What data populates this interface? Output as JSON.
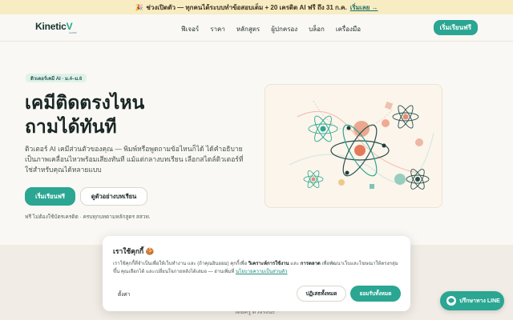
{
  "announcement": {
    "icon": "party-popper-icon",
    "text": "ช่วงเปิดตัว — ทุกคนได้ระบบทำข้อสอบเต็ม + 20 เครดิต AI ฟรี ถึง 31 ก.ค.",
    "cta": "เริ่มเลย →"
  },
  "nav": {
    "logo_main": "Kinetic",
    "logo_accent": "V",
    "logo_sub": "LEARN",
    "links": [
      "ฟีเจอร์",
      "ราคา",
      "หลักสูตร",
      "ผู้ปกครอง",
      "บล็อก",
      "เครื่องมือ"
    ],
    "cta": "เริ่มเรียนฟรี"
  },
  "hero": {
    "badge": "ติวเตอร์เคมี AI · ม.4–ม.6",
    "title_line1": "เคมีติดตรงไหน",
    "title_line2": "ถามได้ทันที",
    "description": "ติวเตอร์ AI เคมีส่วนตัวของคุณ — พิมพ์หรือพูดถามข้อไหนก็ได้ ได้คำอธิบายเป็นภาพเคลื่อนไหวพร้อมเสียงทันที แม้แต่กลางบทเรียน เลือกสไตล์ติวเตอร์ที่ใช่สำหรับคุณได้หลายแบบ",
    "primary_button": "เริ่มเรียนฟรี",
    "secondary_button": "ดูตัวอย่างบทเรียน",
    "note": "ฟรี ไม่ต้องใช้บัตรเครดิต · ครบทุกบทตามหลักสูตร สสวท."
  },
  "lower_section": {
    "text": "โดยครู ตัวจริงนะ"
  },
  "cookie": {
    "title": "เราใช้คุกกี้ 🍪",
    "body_1": "เราใช้คุกกี้ที่จำเป็นเพื่อให้เว็บทำงาน และ (ถ้าคุณยินยอม) คุกกี้เพื่อ ",
    "body_bold_1": "วิเคราะห์การใช้งาน",
    "body_2": " และ ",
    "body_bold_2": "การตลาด",
    "body_3": " เพื่อพัฒนาเว็บและโฆษณาให้ตรงกลุ่มขึ้น คุณเลือกได้ และเปลี่ยนใจภายหลังได้เสมอ — อ่านเพิ่มที่ ",
    "link": "นโยบายความเป็นส่วนตัว",
    "settings": "ตั้งค่า",
    "reject": "ปฏิเสธทั้งหมด",
    "accept": "ยอมรับทั้งหมด"
  },
  "line_chat": {
    "icon": "line-chat-icon",
    "label": "ปรึกษาทาง LINE"
  },
  "colors": {
    "accent": "#2aa692",
    "background": "#faf8f4",
    "announcement_bg": "#f7ecc2"
  }
}
